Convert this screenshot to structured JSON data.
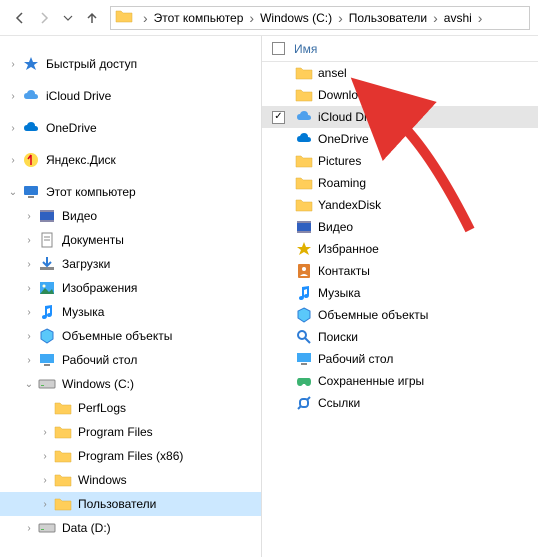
{
  "breadcrumb": [
    "Этот компьютер",
    "Windows (C:)",
    "Пользователи",
    "avshi"
  ],
  "list_header": {
    "name_col": "Имя"
  },
  "tree": {
    "quick_access": "Быстрый доступ",
    "icloud": "iCloud Drive",
    "onedrive": "OneDrive",
    "yandex": "Яндекс.Диск",
    "this_pc": "Этот компьютер",
    "videos": "Видео",
    "documents": "Документы",
    "downloads": "Загрузки",
    "images": "Изображения",
    "music": "Музыка",
    "objects3d": "Объемные объекты",
    "desktop": "Рабочий стол",
    "c_drive": "Windows (C:)",
    "perflogs": "PerfLogs",
    "program_files": "Program Files",
    "program_files_x86": "Program Files (x86)",
    "windows_folder": "Windows",
    "users": "Пользователи",
    "d_drive": "Data (D:)"
  },
  "list": {
    "ansel": "ansel",
    "downloads": "Downloads",
    "icloud": "iCloud Drive",
    "onedrive": "OneDrive",
    "pictures": "Pictures",
    "roaming": "Roaming",
    "yandexdisk": "YandexDisk",
    "videos": "Видео",
    "favorites": "Избранное",
    "contacts": "Контакты",
    "music": "Музыка",
    "objects3d": "Объемные объекты",
    "searches": "Поиски",
    "desktop": "Рабочий стол",
    "savedgames": "Сохраненные игры",
    "links": "Ссылки"
  },
  "icons": {
    "folder": "#FFCE5A",
    "folder_stroke": "#DFAF3A",
    "disk": "#A0A0A0",
    "cloud_blue": "#1E90FF",
    "onedrive_blue": "#0078D4",
    "star": "#2E7CD6",
    "pc": "#2E7CD6",
    "video": "#3060C0",
    "music": "#1E90FF",
    "desktop": "#3060C0",
    "yandex": "#E0B000",
    "star_fav": "#E0B000",
    "contacts": "#E08030",
    "search": "#2E7CD6",
    "games": "#3CB371",
    "link": "#2E7CD6"
  }
}
